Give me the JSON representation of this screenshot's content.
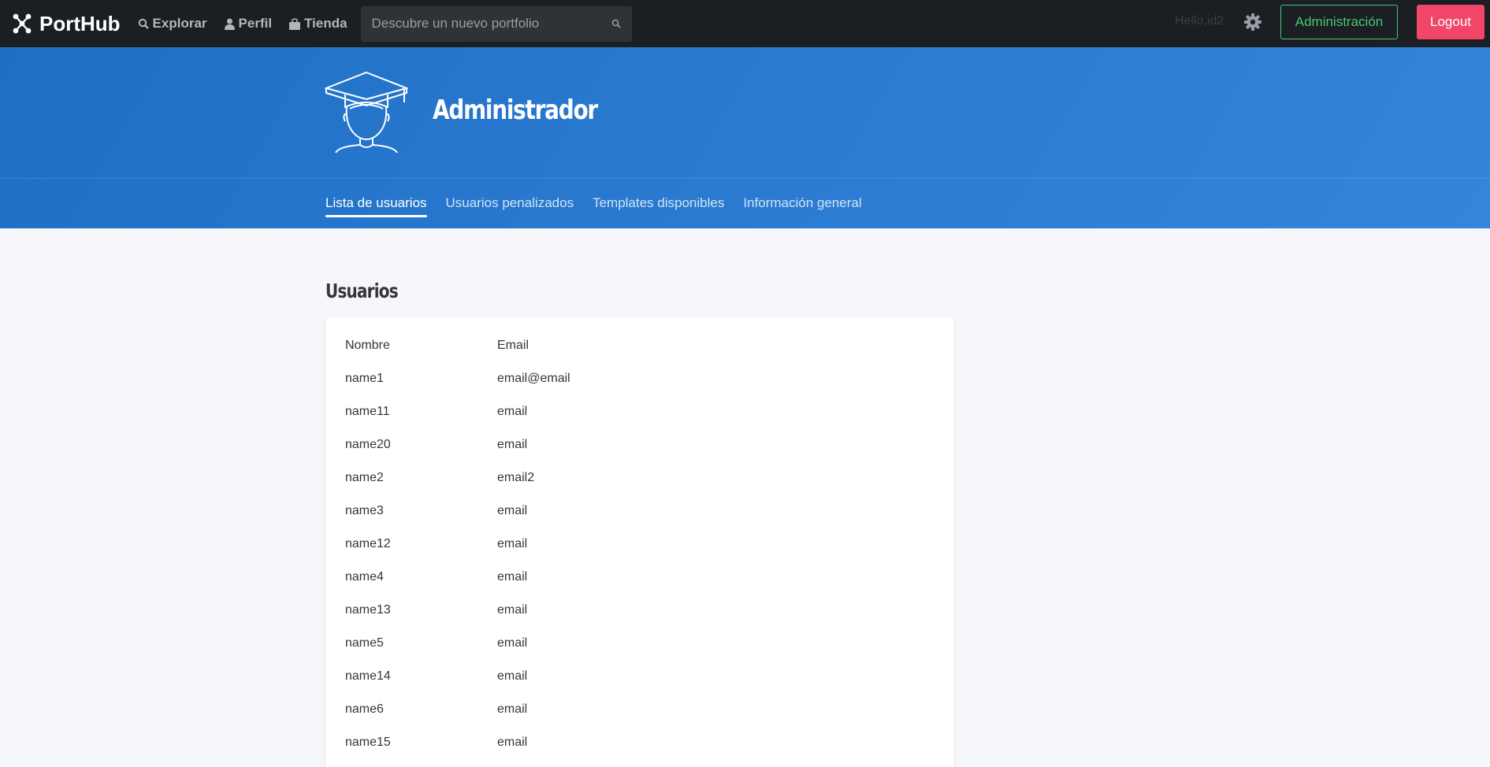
{
  "nav": {
    "brand": "PortHub",
    "links": [
      {
        "label": "Explorar",
        "icon": "search-icon"
      },
      {
        "label": "Perfil",
        "icon": "user-icon"
      },
      {
        "label": "Tienda",
        "icon": "shopping-bag-icon"
      }
    ],
    "search_placeholder": "Descubre un nuevo portfolio",
    "hello": "Hello,id2",
    "admin_button": "Administración",
    "logout_button": "Logout"
  },
  "hero": {
    "title": "Administrador",
    "tabs": [
      {
        "label": "Lista de usuarios",
        "active": true
      },
      {
        "label": "Usuarios penalizados",
        "active": false
      },
      {
        "label": "Templates disponibles",
        "active": false
      },
      {
        "label": "Información general",
        "active": false
      }
    ]
  },
  "users": {
    "title": "Usuarios",
    "columns": [
      "Nombre",
      "Email"
    ],
    "rows": [
      [
        "name1",
        "email@email"
      ],
      [
        "name11",
        "email"
      ],
      [
        "name20",
        "email"
      ],
      [
        "name2",
        "email2"
      ],
      [
        "name3",
        "email"
      ],
      [
        "name12",
        "email"
      ],
      [
        "name4",
        "email"
      ],
      [
        "name13",
        "email"
      ],
      [
        "name5",
        "email"
      ],
      [
        "name14",
        "email"
      ],
      [
        "name6",
        "email"
      ],
      [
        "name15",
        "email"
      ]
    ]
  },
  "colors": {
    "navbar": "#1b1e23",
    "hero": "#2b7bd2",
    "admin_green": "#48c774",
    "logout_red": "#f14668"
  }
}
